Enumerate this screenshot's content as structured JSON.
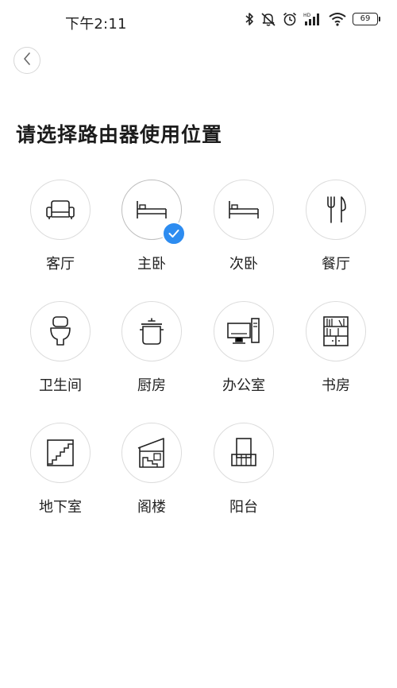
{
  "status_bar": {
    "time": "下午2:11",
    "battery": "69",
    "icons": [
      "bluetooth-icon",
      "mute-icon",
      "alarm-icon",
      "hd-signal-icon",
      "wifi-icon",
      "battery-icon"
    ]
  },
  "header": {
    "back_icon": "chevron-left-icon"
  },
  "page": {
    "title": "请选择路由器使用位置"
  },
  "locations": [
    {
      "label": "客厅",
      "icon": "sofa-icon",
      "selected": false
    },
    {
      "label": "主卧",
      "icon": "bed-icon",
      "selected": true
    },
    {
      "label": "次卧",
      "icon": "bed-icon",
      "selected": false
    },
    {
      "label": "餐厅",
      "icon": "fork-knife-icon",
      "selected": false
    },
    {
      "label": "卫生间",
      "icon": "toilet-icon",
      "selected": false
    },
    {
      "label": "厨房",
      "icon": "cooking-pot-icon",
      "selected": false
    },
    {
      "label": "办公室",
      "icon": "computer-icon",
      "selected": false
    },
    {
      "label": "书房",
      "icon": "bookshelf-icon",
      "selected": false
    },
    {
      "label": "地下室",
      "icon": "stairs-icon",
      "selected": false
    },
    {
      "label": "阁楼",
      "icon": "attic-icon",
      "selected": false
    },
    {
      "label": "阳台",
      "icon": "balcony-icon",
      "selected": false
    }
  ],
  "colors": {
    "accent": "#2d8cf0",
    "border": "#dcdcdc",
    "text": "#222222"
  }
}
